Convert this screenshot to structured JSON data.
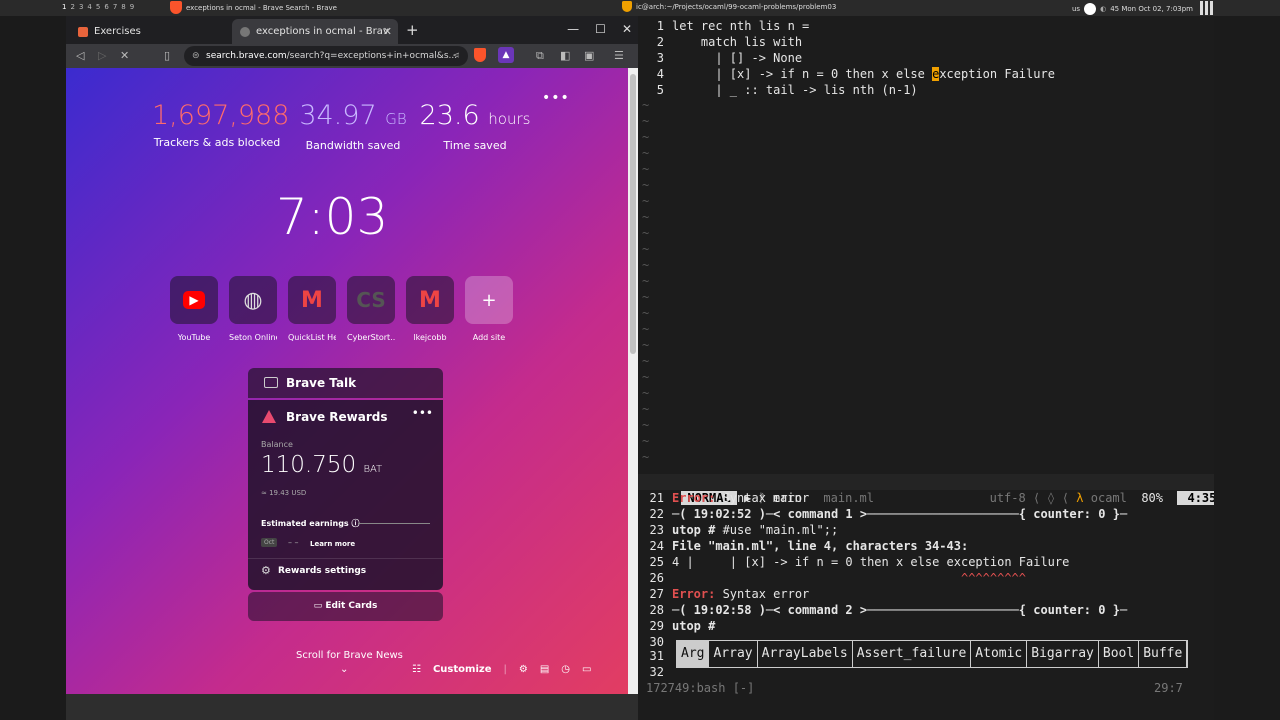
{
  "wm": {
    "workspaces": [
      "1",
      "2",
      "3",
      "4",
      "5",
      "6",
      "7",
      "8",
      "9"
    ],
    "left_title": "exceptions in ocmal - Brave Search - Brave",
    "right_title": "ic@arch:~/Projects/ocaml/99-ocaml-problems/problem03",
    "clock": "45 Mon Oct 02, 7:03pm",
    "kb": "us"
  },
  "browser": {
    "tabs": [
      {
        "label": "Exercises"
      },
      {
        "label": "exceptions in ocmal - Brav"
      }
    ],
    "url_host": "search.brave.com",
    "url_rest": "/search?q=exceptions+in+ocmal&s...",
    "stats": [
      {
        "value": "1,697,988",
        "unit": "",
        "label": "Trackers & ads blocked",
        "color": "#ff6b6b"
      },
      {
        "value": "34.97",
        "unit": "GB",
        "label": "Bandwidth saved",
        "color": "#c9b8ff"
      },
      {
        "value": "23.6",
        "unit": "hours",
        "label": "Time saved",
        "color": "#ffffff"
      }
    ],
    "clock": "7:03",
    "sites": [
      {
        "label": "YouTube",
        "icon": "youtube-icon",
        "glyph": "▶"
      },
      {
        "label": "Seton Online",
        "icon": "globe-icon",
        "glyph": "◍"
      },
      {
        "label": "QuickList He...",
        "icon": "gmail-icon",
        "glyph": "M"
      },
      {
        "label": "CyberStort...",
        "icon": "cs-icon",
        "glyph": "CS"
      },
      {
        "label": "lkejcobb",
        "icon": "gmail-icon",
        "glyph": "M"
      },
      {
        "label": "Add site",
        "icon": "plus-icon",
        "glyph": "+"
      }
    ],
    "talk_title": "Brave Talk",
    "rewards": {
      "title": "Brave Rewards",
      "balance_label": "Balance",
      "amount": "110.750",
      "currency": "BAT",
      "usd": "≈ 19.43 USD",
      "estimated": "Estimated earnings",
      "month": "Oct",
      "dash": "– –",
      "learn": "Learn more",
      "settings": "Rewards settings"
    },
    "edit_cards": "Edit Cards",
    "scroll_news": "Scroll for Brave News",
    "customize": "Customize"
  },
  "editor": {
    "lines": [
      {
        "n": "1",
        "code": "let rec nth lis n ="
      },
      {
        "n": "2",
        "code": "    match lis with"
      },
      {
        "n": "3",
        "code": "      | [] -> None"
      },
      {
        "n": "4",
        "pre": "      | [x] -> if n = 0 then x else ",
        "cur": "e",
        "post": "xception Failure"
      },
      {
        "n": "5",
        "code": "      | _ :: tail -> lis nth (n-1)"
      }
    ],
    "mode": "NORMAL",
    "branch": "main",
    "file": "main.ml",
    "encoding": "utf-8",
    "filetype": "ocaml",
    "percent": "80%",
    "position": "4:35"
  },
  "repl": {
    "lines": [
      {
        "n": "21",
        "err": "Error:",
        "text": " Syntax error"
      },
      {
        "n": "22",
        "bold": "─( 19:02:52 )─< command 1 >─────────────────────{ counter: 0 }─"
      },
      {
        "n": "23",
        "bold": "utop # ",
        "text": "#use \"main.ml\";;"
      },
      {
        "n": "24",
        "bold": "File \"main.ml\", line 4, characters 34-43:"
      },
      {
        "n": "25",
        "text": "4 |     | [x] -> if n = 0 then x else exception Failure"
      },
      {
        "n": "26",
        "text": "                                        ^^^^^^^^^"
      },
      {
        "n": "27",
        "err": "Error:",
        "text": " Syntax error"
      },
      {
        "n": "28",
        "bold": "─( 19:02:58 )─< command 2 >─────────────────────{ counter: 0 }─"
      },
      {
        "n": "29",
        "bold": "utop # "
      },
      {
        "n": "30",
        "text": ""
      }
    ],
    "completions": [
      "Arg",
      "Array",
      "ArrayLabels",
      "Assert_failure",
      "Atomic",
      "Bigarray",
      "Bool",
      "Buffe"
    ],
    "line31": "31",
    "line32": "32",
    "status_left": "172749:bash [-]",
    "status_right": "29:7"
  }
}
